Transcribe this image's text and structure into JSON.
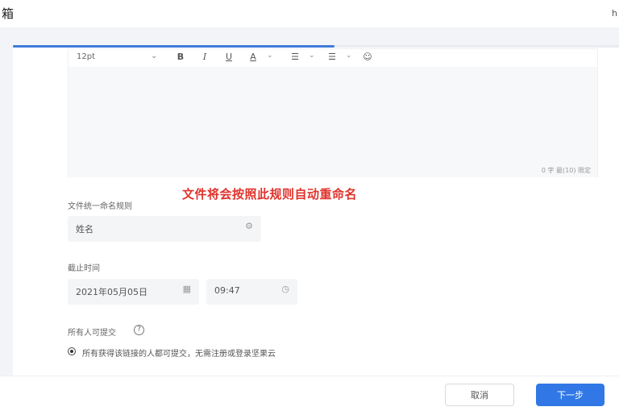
{
  "header": {
    "title": "箱",
    "right_text": "h"
  },
  "progress": {
    "fraction": 0.53,
    "color": "#3e7bd9"
  },
  "editor": {
    "font_size": "12pt",
    "toolbar": {
      "bold": "B",
      "italic": "I",
      "underline": "U",
      "font_color": "A",
      "bullet_list": "☰",
      "numbered_list": "☰",
      "emoji": "☺"
    },
    "counter": "0 字  最(10)  限定"
  },
  "annotation": {
    "text": "文件将会按照此规则自动重命名",
    "color": "#e0322b"
  },
  "naming_rule": {
    "label": "文件统一命名规则",
    "value": "姓名"
  },
  "deadline": {
    "label": "截止时间",
    "date": "2021年05月05日",
    "time": "09:47"
  },
  "submitters": {
    "label": "所有人可提交",
    "option": "所有获得该链接的人都可提交，无需注册或登录坚果云"
  },
  "footer": {
    "cancel_label": "取消",
    "next_label": "下一步"
  },
  "colors": {
    "primary": "#3178e6",
    "annotation": "#e0322b"
  }
}
